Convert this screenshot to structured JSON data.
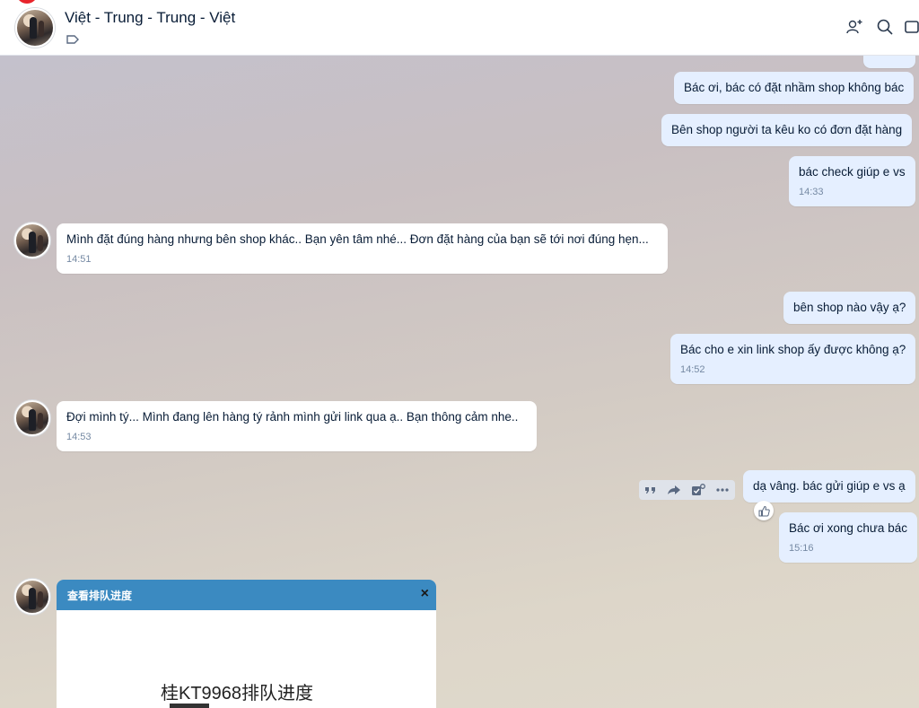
{
  "header": {
    "title": "Việt - Trung - Trung - Việt"
  },
  "messages": {
    "m1": {
      "text": "Bác ơi, bác có đặt nhầm shop không bác"
    },
    "m2": {
      "text": "Bên shop người ta kêu ko có đơn đặt hàng"
    },
    "m3": {
      "text": "bác check giúp e vs",
      "time": "14:33"
    },
    "m4": {
      "text": "Mình đặt đúng hàng nhưng bên shop khác.. Bạn yên tâm nhé... Đơn đặt hàng của bạn sẽ tới nơi đúng hẹn...",
      "time": "14:51"
    },
    "m5": {
      "text": "bên shop nào vậy ạ?"
    },
    "m6": {
      "text": "Bác cho e xin link shop ấy được không ạ?",
      "time": "14:52"
    },
    "m7": {
      "text": "Đợi mình tý... Mình đang lên hàng tý rảnh mình gửi link qua ạ.. Bạn thông cảm nhe..",
      "time": "14:53"
    },
    "m8": {
      "text": "dạ vâng. bác gửi giúp e vs ạ"
    },
    "m9": {
      "text": "Bác ơi xong chưa bác",
      "time": "15:16"
    }
  },
  "card": {
    "title": "查看排队进度",
    "close": "×",
    "heading": "桂KT9968排队进度"
  },
  "icons": {
    "header": [
      "add-member-icon",
      "search-icon",
      "video-call-icon"
    ],
    "actions": [
      "quote-icon",
      "forward-icon",
      "task-icon",
      "more-icon"
    ],
    "reaction": "thumbs-up-icon"
  },
  "colors": {
    "my_bubble": "#e5efff",
    "their_bubble": "#ffffff",
    "card_header": "#3b8ac1",
    "time_text": "#7589a3"
  }
}
